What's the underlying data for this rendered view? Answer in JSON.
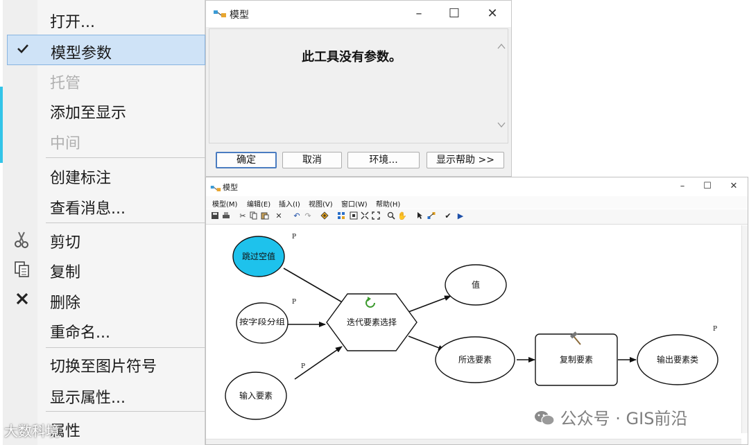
{
  "context_menu": {
    "items": [
      {
        "label": "打开...",
        "enabled": true
      },
      {
        "label": "模型参数",
        "enabled": true,
        "checked": true,
        "selected": true
      },
      {
        "label": "托管",
        "enabled": false
      },
      {
        "label": "添加至显示",
        "enabled": true
      },
      {
        "label": "中间",
        "enabled": false
      },
      {
        "label": "创建标注",
        "enabled": true
      },
      {
        "label": "查看消息...",
        "enabled": true
      },
      {
        "label": "剪切",
        "enabled": true,
        "icon": "scissors-icon"
      },
      {
        "label": "复制",
        "enabled": true,
        "icon": "copy-icon"
      },
      {
        "label": "删除",
        "enabled": true,
        "icon": "delete-icon"
      },
      {
        "label": "重命名...",
        "enabled": true
      },
      {
        "label": "切换至图片符号",
        "enabled": true
      },
      {
        "label": "显示属性...",
        "enabled": true
      },
      {
        "label": "属性",
        "enabled": true
      }
    ]
  },
  "dialog": {
    "title": "模型",
    "message": "此工具没有参数。",
    "buttons": {
      "ok": "确定",
      "cancel": "取消",
      "environments": "环境...",
      "help": "显示帮助 >>"
    }
  },
  "model_builder": {
    "title": "模型",
    "menus": [
      "模型(M)",
      "编辑(E)",
      "插入(I)",
      "视图(V)",
      "窗口(W)",
      "帮助(H)"
    ],
    "nodes": {
      "skip_null": "跳过空值",
      "group_by_field": "按字段分组",
      "input_features": "输入要素",
      "iterator": "迭代要素选择",
      "value": "值",
      "selected_features": "所选要素",
      "copy_features": "复制要素",
      "output_feature_class": "输出要素类"
    },
    "param_marker": "P",
    "colors": {
      "skip_null_fill": "#1ec2ec"
    }
  },
  "watermarks": {
    "right": "公众号 · GIS前沿",
    "left": "大数科境"
  }
}
